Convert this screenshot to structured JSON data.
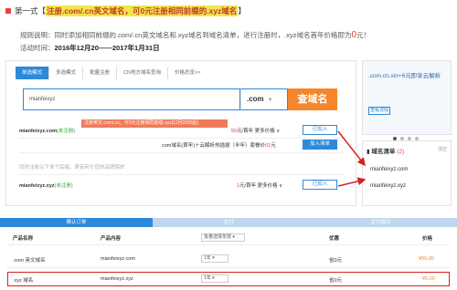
{
  "header": {
    "bullet": "第一式",
    "bracket_open": "【",
    "highlight": "注册.com/.cn英文域名，可0元注册相同前缀的.xyz域名",
    "bracket_close": "】"
  },
  "rules": {
    "label": "规则说明：",
    "text1": "同时添加相同前缀的.com/.cn英文域名和.xyz域名到域名清单，进行注册时，.xyz域名首年价格即为",
    "zero": "0",
    "yuan": "元！",
    "period_label": "活动时间：",
    "period": "2016年12月20——2017年1月31日"
  },
  "tabs": [
    "单选模式",
    "多选模式",
    "批量注册",
    "CN地方域名查询",
    "价格总览>>"
  ],
  "search": {
    "value": "mianfeixyz",
    "tld": ".com",
    "button": "查域名"
  },
  "results": [
    {
      "name": "mianfeixyz.com",
      "status": "(未注册)",
      "price": "55",
      "price_unit": "元/首年",
      "more": "更多价格 ∨",
      "button": "已加入"
    },
    {
      "bundle": "com域名(首年)＋云解析热插拔（半年）套餐价",
      "bundle_price": "61",
      "bundle_unit": "元",
      "button": "加入清单"
    }
  ],
  "hint": "同时注册以下多个后缀，更有利于您的品牌保护",
  "xyz_row": {
    "name": "mianfeixyz.xyz",
    "status": "(未注册)",
    "promo": "注册英文.com/.cn，可0元注册相同前缀.xyz(12月20日起)",
    "price": "1",
    "price_unit": "元/首年",
    "more": "更多价格 ∨",
    "button": "已加入"
  },
  "ad": {
    "text": ".com.cn.xin+6元即享云解析",
    "button": "查看详情"
  },
  "cart": {
    "title": "域名清单",
    "count": "(2)",
    "clear": "清空",
    "items": [
      "mianfeixyz.com",
      "mianfeixyz.xyz"
    ]
  },
  "steps": [
    "确认订单",
    "支付",
    "支付成功"
  ],
  "table": {
    "headers": [
      "产品名称",
      "产品内容",
      "批量选择年限",
      "优惠",
      "价格"
    ],
    "rows": [
      {
        "product": ".com 英文域名",
        "content": "mianfeixyz.com",
        "years": "1年",
        "discount": "省0元",
        "price": "¥55.00"
      },
      {
        "product": ".xyz 域名",
        "content": "mianfeixyz.xyz",
        "years": "1年",
        "discount": "省0元",
        "price": "¥0.00"
      }
    ]
  },
  "colors": {
    "accent": "#2d89d9",
    "orange": "#f6862b",
    "red": "#e3433a"
  }
}
